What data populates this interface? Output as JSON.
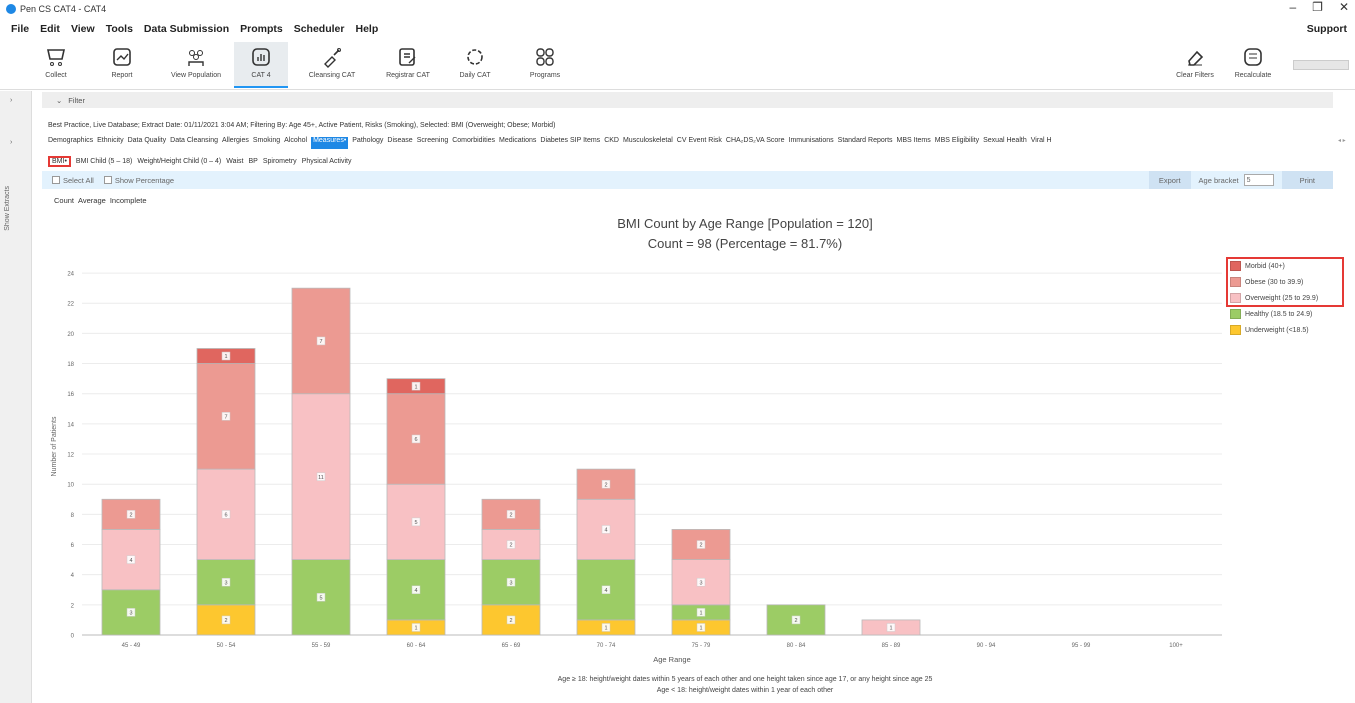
{
  "window": {
    "title": "Pen CS CAT4 - CAT4",
    "minimize": "–",
    "restore": "❐",
    "close": "✕"
  },
  "menu": [
    "File",
    "Edit",
    "View",
    "Tools",
    "Data Submission",
    "Prompts",
    "Scheduler",
    "Help"
  ],
  "menu_support": "Support",
  "ribbon": {
    "items": [
      {
        "label": "Collect",
        "icon": "cart-icon"
      },
      {
        "label": "Report",
        "icon": "report-icon"
      },
      {
        "label": "View Population",
        "icon": "population-icon"
      },
      {
        "label": "CAT 4",
        "icon": "cat4-icon"
      },
      {
        "label": "Cleansing CAT",
        "icon": "cleansing-icon"
      },
      {
        "label": "Registrar CAT",
        "icon": "registrar-icon"
      },
      {
        "label": "Daily CAT",
        "icon": "daily-icon"
      },
      {
        "label": "Programs",
        "icon": "programs-icon"
      }
    ],
    "right_items": [
      {
        "label": "Clear Filters",
        "icon": "eraser-icon"
      },
      {
        "label": "Recalculate",
        "icon": "calculator-icon"
      }
    ]
  },
  "left_panel": {
    "label": "Show Extracts",
    "arrow": "›"
  },
  "filter": {
    "label": "Filter",
    "toggle": "⌄"
  },
  "info_line": "Best Practice, Live Database; Extract Date: 01/11/2021 3:04 AM; Filtering By: Age 45+, Active Patient, Risks (Smoking), Selected: BMI (Overweight; Obese; Morbid)",
  "tabs_main": [
    "Demographics",
    "Ethnicity",
    "Data Quality",
    "Data Cleansing",
    "Allergies",
    "Smoking",
    "Alcohol",
    "Measures•",
    "Pathology",
    "Disease",
    "Screening",
    "Comorbidities",
    "Medications",
    "Diabetes SIP Items",
    "CKD",
    "Musculoskeletal",
    "CV Event Risk",
    "CHA₂DS₂VA Score",
    "Immunisations",
    "Standard Reports",
    "MBS Items",
    "MBS Eligibility",
    "Sexual Health",
    "Viral H"
  ],
  "tabs_main_active": "Measures•",
  "tabs_more": "◂ ▸",
  "tabs_sub": [
    "BMI•",
    "BMI Child (5 – 18)",
    "Weight/Height Child (0 – 4)",
    "Waist",
    "BP",
    "Spirometry",
    "Physical Activity"
  ],
  "options": {
    "select_all": "Select All",
    "show_percentage": "Show Percentage",
    "export": "Export",
    "age_bracket_label": "Age bracket",
    "age_bracket_value": "5",
    "print": "Print"
  },
  "count_tabs": [
    "Count",
    "Average",
    "Incomplete"
  ],
  "chart_title_line1": "BMI Count by Age Range [Population = 120]",
  "chart_title_line2": "Count = 98  (Percentage = 81.7%)",
  "footnote_line1": "Age ≥ 18: height/weight dates within 5 years of each other and one height taken since age 17, or any height since age 25",
  "footnote_line2": "Age < 18: height/weight dates within 1 year of each other",
  "chart_data": {
    "type": "bar",
    "stacked": true,
    "xlabel": "Age Range",
    "ylabel": "Number of Patients",
    "ylim": [
      0,
      25
    ],
    "yticks": [
      0,
      2,
      4,
      6,
      8,
      10,
      12,
      14,
      16,
      18,
      20,
      22,
      24
    ],
    "grid": true,
    "legend_position": "right",
    "categories": [
      "45 - 49",
      "50 - 54",
      "55 - 59",
      "60 - 64",
      "65 - 69",
      "70 - 74",
      "75 - 79",
      "80 - 84",
      "85 - 89",
      "90 - 94",
      "95 - 99",
      "100+"
    ],
    "series": [
      {
        "name": "Underweight (<18.5)",
        "color": "#fdc72f",
        "values": [
          0,
          2,
          0,
          1,
          2,
          1,
          1,
          0,
          0,
          0,
          0,
          0
        ]
      },
      {
        "name": "Healthy (18.5 to 24.9)",
        "color": "#9ccc65",
        "values": [
          3,
          3,
          5,
          4,
          3,
          4,
          1,
          2,
          0,
          0,
          0,
          0
        ]
      },
      {
        "name": "Overweight (25 to 29.9)",
        "color": "#f8c1c4",
        "values": [
          4,
          6,
          11,
          5,
          2,
          4,
          3,
          0,
          1,
          0,
          0,
          0
        ]
      },
      {
        "name": "Obese (30 to 39.9)",
        "color": "#ec9a92",
        "values": [
          2,
          7,
          7,
          6,
          2,
          2,
          2,
          0,
          0,
          0,
          0,
          0
        ]
      },
      {
        "name": "Morbid (40+)",
        "color": "#e0665f",
        "values": [
          0,
          1,
          0,
          1,
          0,
          0,
          0,
          0,
          0,
          0,
          0,
          0
        ]
      }
    ],
    "legend_order": [
      "Morbid (40+)",
      "Obese (30 to 39.9)",
      "Overweight (25 to 29.9)",
      "Healthy (18.5 to 24.9)",
      "Underweight (<18.5)"
    ]
  }
}
